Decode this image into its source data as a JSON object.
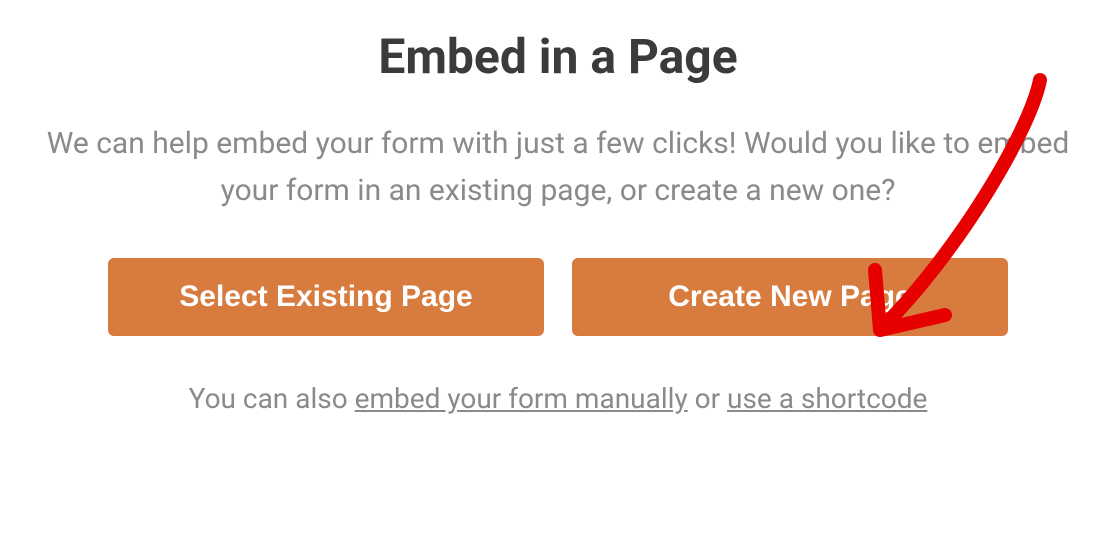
{
  "title": "Embed in a Page",
  "subtitle": "We can help embed your form with just a few clicks! Would you like to embed your form in an existing page, or create a new one?",
  "buttons": {
    "existing": "Select Existing Page",
    "new": "Create New Page"
  },
  "footer": {
    "prefix": "You can also ",
    "link1": "embed your form manually",
    "middle": " or ",
    "link2": "use a shortcode"
  },
  "annotation": {
    "type": "arrow",
    "color": "#e60000",
    "target": "create-new-page-button"
  }
}
